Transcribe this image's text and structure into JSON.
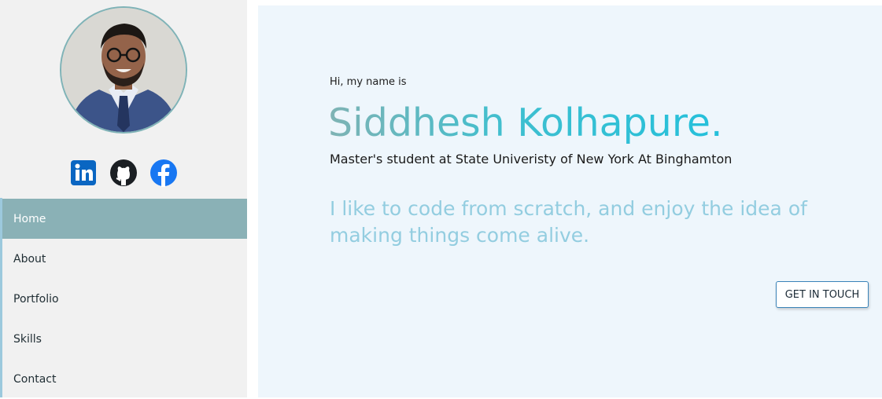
{
  "sidebar": {
    "avatar": "profile-photo",
    "social": [
      {
        "icon": "linkedin-icon",
        "color": "#0a66c2"
      },
      {
        "icon": "github-icon",
        "color": "#1b1f23"
      },
      {
        "icon": "facebook-icon",
        "color": "#1877f2"
      }
    ],
    "nav": [
      {
        "label": "Home",
        "active": true
      },
      {
        "label": "About"
      },
      {
        "label": "Portfolio"
      },
      {
        "label": "Skills"
      },
      {
        "label": "Contact"
      }
    ]
  },
  "hero": {
    "greeting": "Hi, my name is",
    "name": "Siddhesh Kolhapure.",
    "subtitle": "Master's student at State Univeristy of New York At Binghamton",
    "tagline": "I like to code from scratch, and enjoy the idea of making things come alive.",
    "cta_label": "GET IN TOUCH"
  },
  "colors": {
    "nav_active_bg": "#8ab1b6",
    "main_bg": "#eef6fc",
    "name_gradient": [
      "#7fb3b4",
      "#24c0db"
    ],
    "tagline": "#93cde0"
  }
}
